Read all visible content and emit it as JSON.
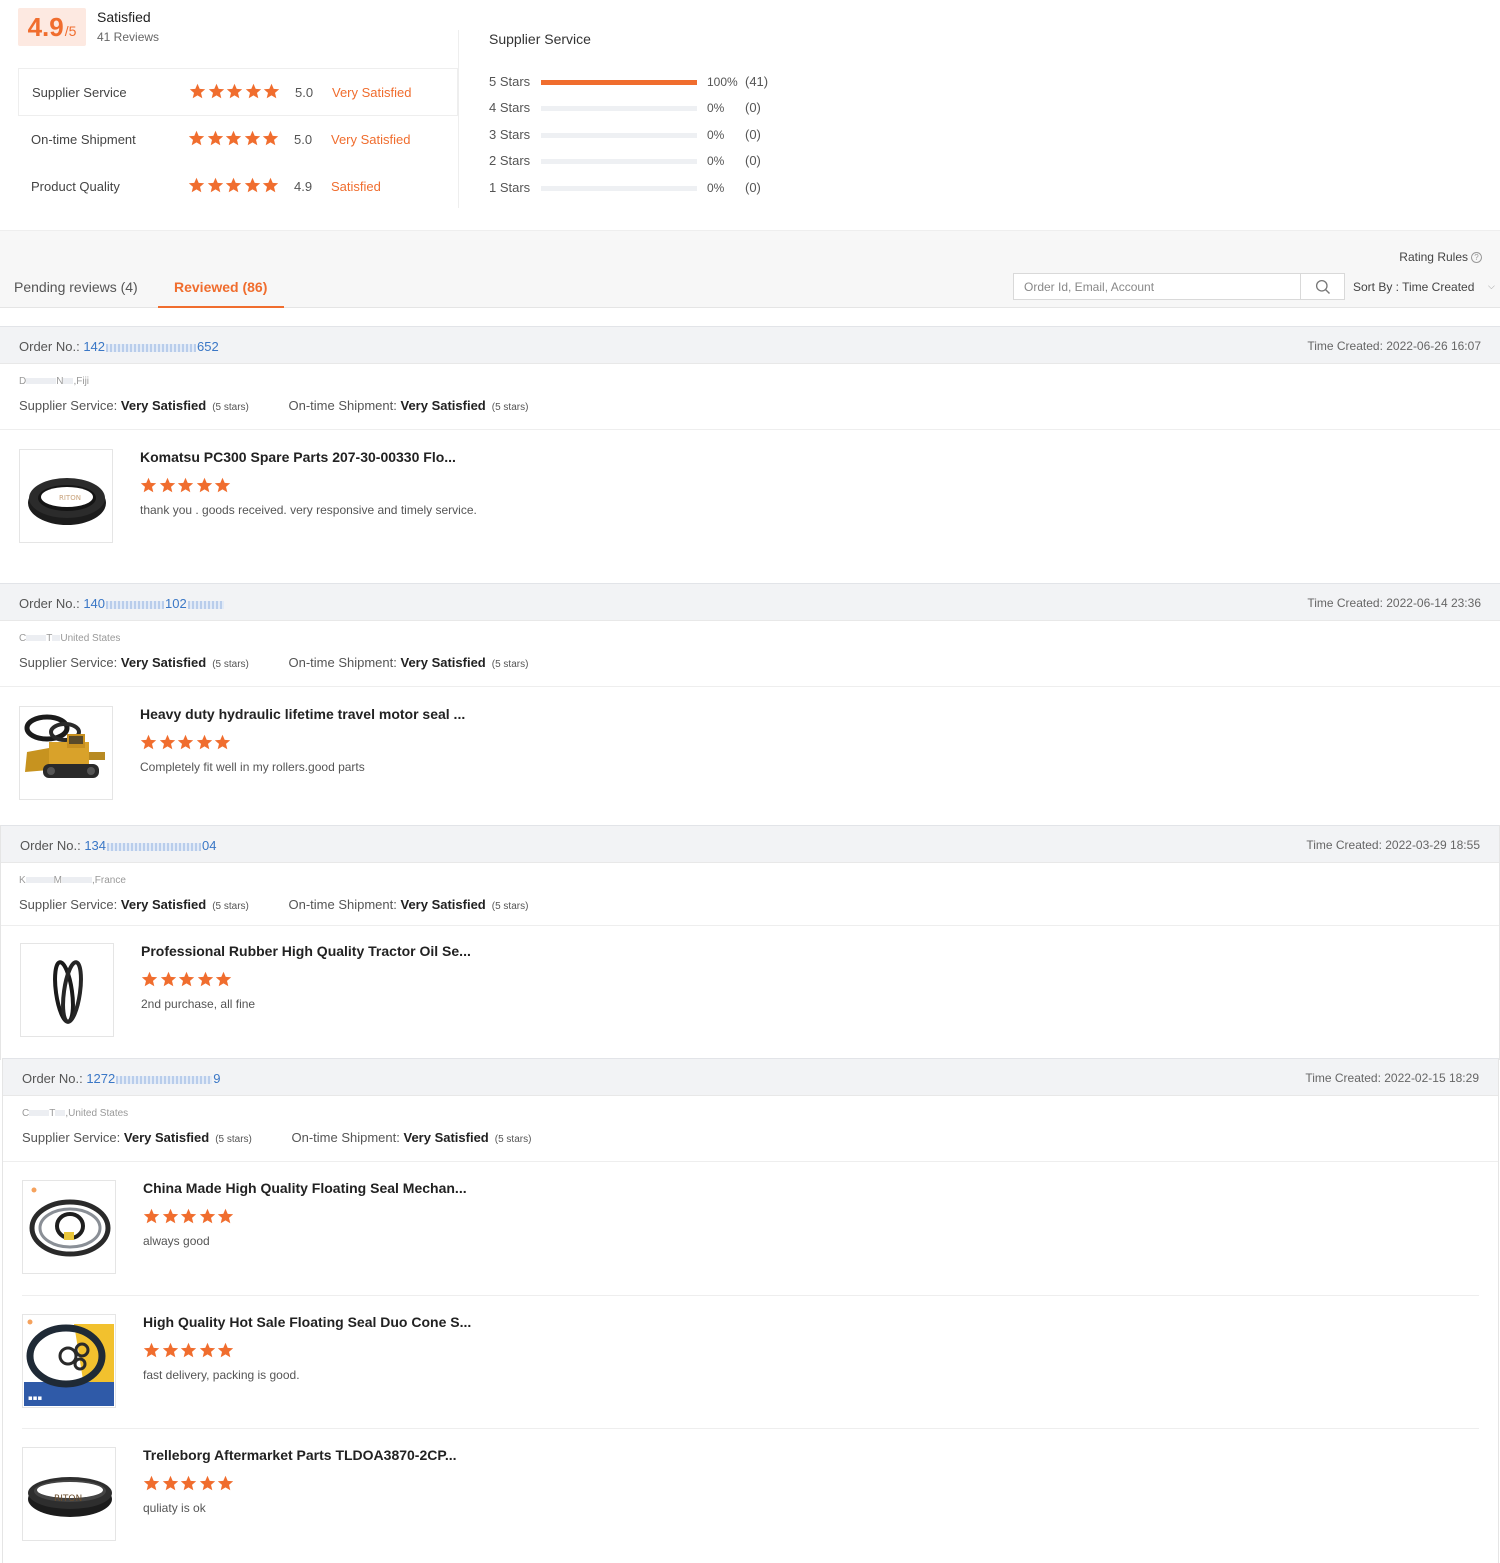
{
  "summary": {
    "score": "4.9",
    "score_suffix": "/5",
    "overall_text": "Satisfied",
    "reviews_count": "41 Reviews",
    "dimensions": [
      {
        "label": "Supplier Service",
        "score": "5.0",
        "text": "Very Satisfied",
        "stars": 5
      },
      {
        "label": "On-time Shipment",
        "score": "5.0",
        "text": "Very Satisfied",
        "stars": 5
      },
      {
        "label": "Product Quality",
        "score": "4.9",
        "text": "Satisfied",
        "stars": 5
      }
    ],
    "distribution_title": "Supplier Service",
    "distribution": [
      {
        "label": "5 Stars",
        "pct": "100%",
        "count": "(41)",
        "fraction": 1.0
      },
      {
        "label": "4 Stars",
        "pct": "0%",
        "count": "(0)",
        "fraction": 0
      },
      {
        "label": "3 Stars",
        "pct": "0%",
        "count": "(0)",
        "fraction": 0
      },
      {
        "label": "2 Stars",
        "pct": "0%",
        "count": "(0)",
        "fraction": 0
      },
      {
        "label": "1 Stars",
        "pct": "0%",
        "count": "(0)",
        "fraction": 0
      }
    ]
  },
  "toolbar": {
    "tab_pending": "Pending reviews (4)",
    "tab_reviewed": "Reviewed (86)",
    "rating_rules": "Rating Rules",
    "search_placeholder": "Order Id, Email, Account",
    "sort_label": "Sort By : Time Created"
  },
  "orders": [
    {
      "order_label": "Order No.:",
      "order_prefix": "142",
      "order_suffix": "652",
      "time_created": "Time Created: 2022-06-26 16:07",
      "buyer_initial": "D",
      "buyer_mid": "N",
      "buyer_country": ",Fiji",
      "supplier_label": "Supplier Service:",
      "supplier_value": "Very Satisfied",
      "supplier_stars": "(5 stars)",
      "shipment_label": "On-time Shipment:",
      "shipment_value": "Very Satisfied",
      "shipment_stars": "(5 stars)",
      "items": [
        {
          "title": "Komatsu PC300 Spare Parts 207-30-00330 Flo...",
          "comment": "thank you . goods received.  very responsive and timely service.",
          "stars": 5,
          "thumb": "seal-ring"
        }
      ]
    },
    {
      "order_label": "Order No.:",
      "order_prefix": "140",
      "order_suffix": "102",
      "time_created": "Time Created: 2022-06-14 23:36",
      "buyer_initial": "C",
      "buyer_mid": "T",
      "buyer_country": "United States",
      "supplier_label": "Supplier Service:",
      "supplier_value": "Very Satisfied",
      "supplier_stars": "(5 stars)",
      "shipment_label": "On-time Shipment:",
      "shipment_value": "Very Satisfied",
      "shipment_stars": "(5 stars)",
      "items": [
        {
          "title": "Heavy duty hydraulic lifetime travel motor seal ...",
          "comment": "Completely fit well in my rollers.good parts",
          "stars": 5,
          "thumb": "bulldozer"
        }
      ]
    },
    {
      "order_label": "Order No.:",
      "order_prefix": "134",
      "order_suffix": "04",
      "time_created": "Time Created: 2022-03-29 18:55",
      "buyer_initial": "K",
      "buyer_mid": "M",
      "buyer_country": ",France",
      "supplier_label": "Supplier Service:",
      "supplier_value": "Very Satisfied",
      "supplier_stars": "(5 stars)",
      "shipment_label": "On-time Shipment:",
      "shipment_value": "Very Satisfied",
      "shipment_stars": "(5 stars)",
      "items": [
        {
          "title": "Professional Rubber High Quality Tractor Oil Se...",
          "comment": "2nd purchase, all fine",
          "stars": 5,
          "thumb": "o-rings"
        }
      ]
    },
    {
      "order_label": "Order No.:",
      "order_prefix": "1272",
      "order_suffix": "9",
      "time_created": "Time Created: 2022-02-15 18:29",
      "buyer_initial": "C",
      "buyer_mid": "T",
      "buyer_country": ",United States",
      "supplier_label": "Supplier Service:",
      "supplier_value": "Very Satisfied",
      "supplier_stars": "(5 stars)",
      "shipment_label": "On-time Shipment:",
      "shipment_value": "Very Satisfied",
      "shipment_stars": "(5 stars)",
      "items": [
        {
          "title": "China Made High Quality Floating Seal Mechan...",
          "comment": "always good",
          "stars": 5,
          "thumb": "floating-seal"
        },
        {
          "title": "High Quality Hot Sale Floating Seal Duo Cone S...",
          "comment": "fast delivery, packing is good.",
          "stars": 5,
          "thumb": "duo-cone"
        },
        {
          "title": "Trelleborg Aftermarket Parts TLDOA3870-2CP...",
          "comment": "quliaty is ok",
          "stars": 5,
          "thumb": "flat-ring"
        }
      ]
    }
  ],
  "colors": {
    "accent": "#f06d2e",
    "link": "#3a77c6",
    "header_bg": "#f2f3f5"
  }
}
